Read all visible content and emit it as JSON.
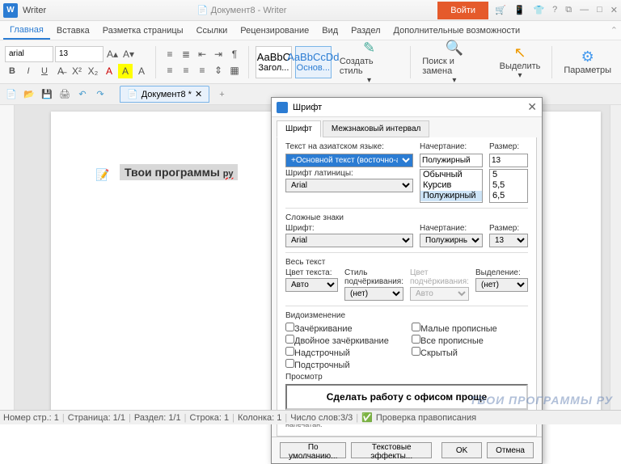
{
  "titlebar": {
    "app": "Writer",
    "doc_center": "Документ8  -  Writer",
    "login": "Войти"
  },
  "menu": [
    "Главная",
    "Вставка",
    "Разметка страницы",
    "Ссылки",
    "Рецензирование",
    "Вид",
    "Раздел",
    "Дополнительные возможности"
  ],
  "ribbon": {
    "font_name": "arial",
    "font_size": "13",
    "styles": [
      {
        "preview": "AaBbC",
        "label": "Загол..."
      },
      {
        "preview": "AaBbCcDd",
        "label": "Основ..."
      }
    ],
    "create_style": "Создать стиль",
    "find_replace": "Поиск и замена",
    "select": "Выделить",
    "options": "Параметры"
  },
  "doc_tab": "Документ8 *",
  "document_text": "Твои программы ру",
  "dialog": {
    "title": "Шрифт",
    "tabs": [
      "Шрифт",
      "Межзнаковый интервал"
    ],
    "asian_label": "Текст на азиатском языке:",
    "asian_value": "+Основной текст (восточно-азиат",
    "style_label": "Начертание:",
    "size_label": "Размер:",
    "style_value": "Полужирный",
    "size_value": "13",
    "style_list": [
      "Обычный",
      "Курсив",
      "Полужирный"
    ],
    "size_list": [
      "5",
      "5,5",
      "6,5"
    ],
    "latin_label": "Шрифт латиницы:",
    "latin_value": "Arial",
    "complex": "Сложные знаки",
    "font_label": "Шрифт:",
    "font_value": "Arial",
    "style_value2": "Полужирный",
    "size_value2": "13",
    "all_text": "Весь текст",
    "color_label": "Цвет текста:",
    "under_style_label": "Стиль подчёркивания:",
    "under_color_label": "Цвет подчёркивания:",
    "highlight_label": "Выделение:",
    "auto": "Авто",
    "none": "(нет)",
    "effects": "Видоизменение",
    "chk": {
      "strike": "Зачёркивание",
      "dstrike": "Двойное зачёркивание",
      "super": "Надстрочный",
      "sub": "Подстрочный",
      "smallcaps": "Малые прописные",
      "allcaps": "Все прописные",
      "hidden": "Скрытый"
    },
    "preview_label": "Просмотр",
    "preview_text": "Сделать работу с офисом проще",
    "note": "Шрифт не был установлен. Наиболее похожий шрифт будет напечатан.",
    "defaults": "По умолчанию...",
    "text_effects": "Текстовые эффекты...",
    "ok": "OK",
    "cancel": "Отмена"
  },
  "status": {
    "page": "Номер стр.: 1",
    "pages": "Страница: 1/1",
    "section": "Раздел: 1/1",
    "line": "Строка: 1",
    "col": "Колонка: 1",
    "words": "Число слов:3/3",
    "spell": "Проверка правописания"
  },
  "watermark": "ТВОИ ПРОГРАММЫ РУ"
}
